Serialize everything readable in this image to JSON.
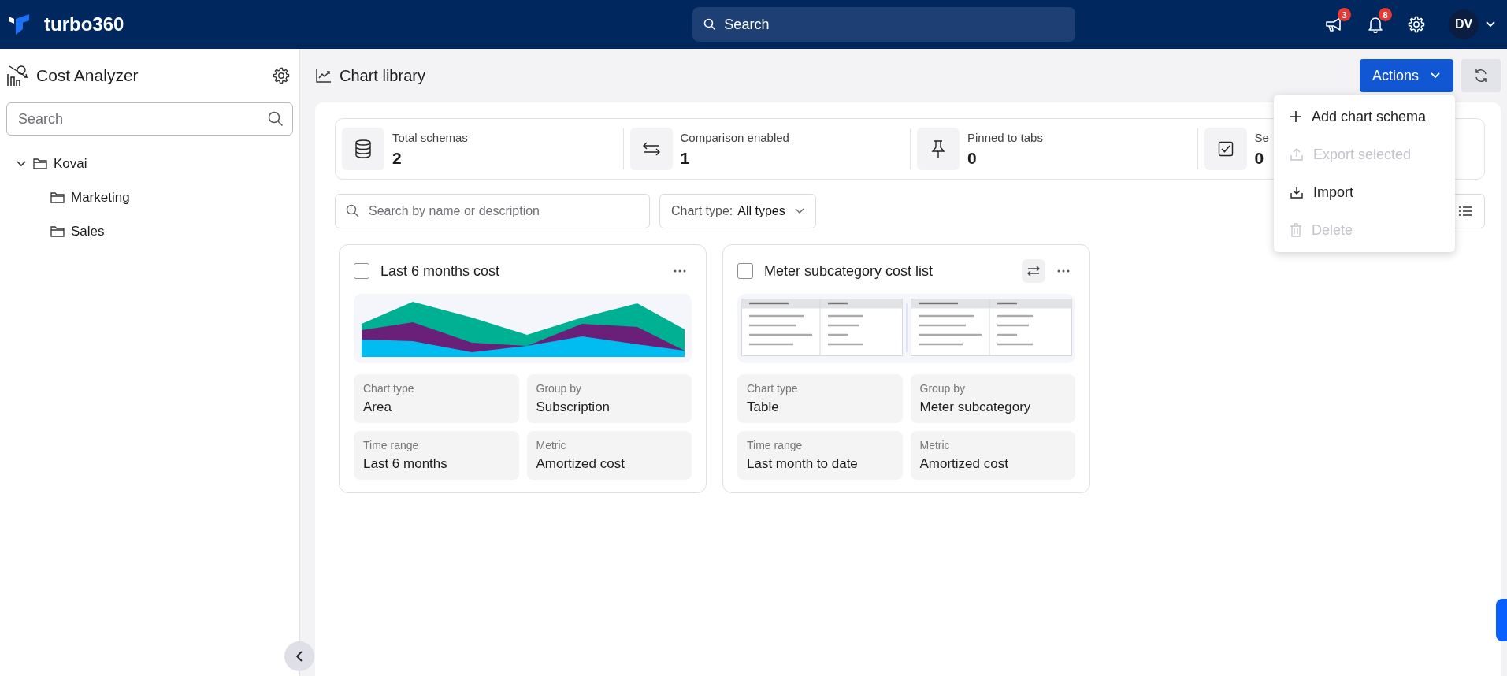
{
  "top_bar": {
    "brand": "turbo360",
    "search": {
      "placeholder": "Search"
    },
    "announcements_badge": "3",
    "notifications_badge": "8",
    "avatar": "DV"
  },
  "sidebar": {
    "title": "Cost Analyzer",
    "search": {
      "placeholder": "Search"
    },
    "tree": [
      {
        "label": "Kovai",
        "expanded": true,
        "children": [
          {
            "label": "Marketing"
          },
          {
            "label": "Sales"
          }
        ]
      }
    ]
  },
  "header": {
    "title": "Chart library",
    "actions_button": "Actions"
  },
  "stats": [
    {
      "kind": "database",
      "label": "Total schemas",
      "value": "2"
    },
    {
      "kind": "arrows",
      "label": "Comparison enabled",
      "value": "1"
    },
    {
      "kind": "pin",
      "label": "Pinned to tabs",
      "value": "0"
    },
    {
      "kind": "check",
      "label": "Se",
      "value": "0"
    }
  ],
  "filters": {
    "search": {
      "placeholder": "Search by name or description"
    },
    "chart_type_label": "Chart type:",
    "chart_type_value": "All types"
  },
  "cards": [
    {
      "kind": "area",
      "title": "Last 6 months cost",
      "checked": false,
      "comparison": false,
      "fields": [
        {
          "label": "Chart type",
          "value": "Area"
        },
        {
          "label": "Group by",
          "value": "Subscription"
        },
        {
          "label": "Time range",
          "value": "Last 6 months"
        },
        {
          "label": "Metric",
          "value": "Amortized cost"
        }
      ]
    },
    {
      "kind": "table",
      "title": "Meter subcategory cost list",
      "checked": false,
      "comparison": true,
      "fields": [
        {
          "label": "Chart type",
          "value": "Table"
        },
        {
          "label": "Group by",
          "value": "Meter subcategory"
        },
        {
          "label": "Time range",
          "value": "Last month to date"
        },
        {
          "label": "Metric",
          "value": "Amortized cost"
        }
      ]
    }
  ],
  "actions_menu": [
    {
      "kind": "add",
      "label": "Add chart schema",
      "disabled": false
    },
    {
      "kind": "export",
      "label": "Export selected",
      "disabled": true
    },
    {
      "kind": "import",
      "label": "Import",
      "disabled": false
    },
    {
      "kind": "delete",
      "label": "Delete",
      "disabled": true
    }
  ]
}
